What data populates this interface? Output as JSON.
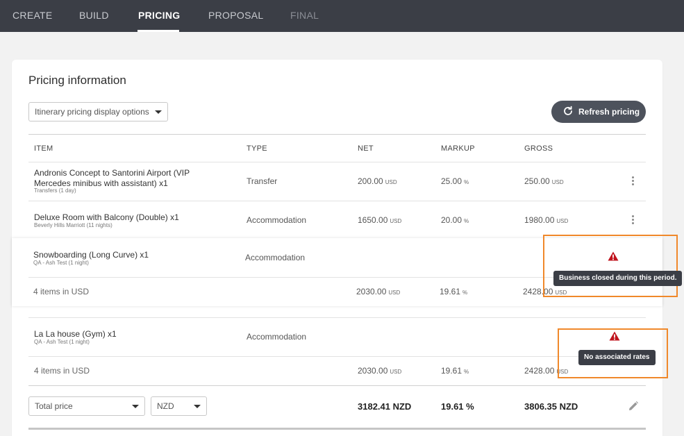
{
  "nav": {
    "tabs": [
      {
        "label": "CREATE"
      },
      {
        "label": "BUILD"
      },
      {
        "label": "PRICING"
      },
      {
        "label": "PROPOSAL"
      },
      {
        "label": "FINAL"
      }
    ],
    "active_tab": "PRICING"
  },
  "pricing": {
    "title": "Pricing information",
    "display_options": "Itinerary pricing display options",
    "refresh_label": "Refresh pricing",
    "columns": [
      "ITEM",
      "TYPE",
      "NET",
      "MARKUP",
      "GROSS"
    ],
    "rows": [
      {
        "name": "Andronis Concept to Santorini Airport (VIP Mercedes minibus with assistant) x1",
        "sub": "Transfers (1 day)",
        "type": "Transfer",
        "net": "200.00",
        "net_unit": "USD",
        "markup": "25.00",
        "markup_unit": "%",
        "gross": "250.00",
        "gross_unit": "USD"
      },
      {
        "name": "Deluxe Room with Balcony (Double) x1",
        "sub": "Beverly Hills Marriott (11 nights)",
        "type": "Accommodation",
        "net": "1650.00",
        "net_unit": "USD",
        "markup": "20.00",
        "markup_unit": "%",
        "gross": "1980.00",
        "gross_unit": "USD"
      },
      {
        "name": "Snowboarding (Long Curve) x1",
        "sub": "QA - Ash Test (1 night)",
        "type": "Accommodation",
        "warning": "Business closed during this period."
      },
      {
        "name": "La La house (Gym) x1",
        "sub": "QA - Ash Test (1 night)",
        "type": "Accommodation",
        "warning": "No associated rates"
      }
    ],
    "summary_1": {
      "label": "4 items in USD",
      "net": "2030.00",
      "net_unit": "USD",
      "markup": "19.61",
      "markup_unit": "%",
      "gross": "2428.00",
      "gross_unit": "USD"
    },
    "summary_2": {
      "label": "4 items in USD",
      "net": "2030.00",
      "net_unit": "USD",
      "markup": "19.61",
      "markup_unit": "%",
      "gross": "2428.00",
      "gross_unit": "USD"
    },
    "totals": {
      "price_type": "Total price",
      "currency": "NZD",
      "net": "3182.41 NZD",
      "markup": "19.61 %",
      "gross": "3806.35 NZD"
    }
  },
  "colors": {
    "nav_bg": "#3b3e46",
    "warning_red": "#c0141e",
    "highlight_orange": "#f0882a",
    "button_bg": "#4d525c"
  },
  "icons": [
    "refresh-icon",
    "kebab-menu-icon",
    "warning-icon",
    "pencil-icon",
    "caret-down-icon"
  ]
}
